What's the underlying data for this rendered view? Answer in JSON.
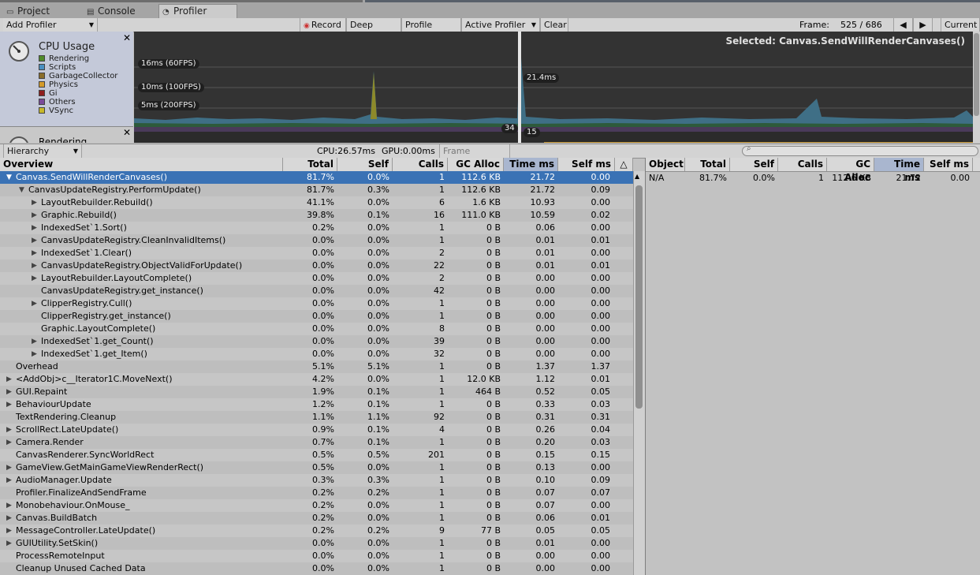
{
  "tabs": [
    {
      "label": "Project",
      "icon": "folder-icon"
    },
    {
      "label": "Console",
      "icon": "console-icon"
    },
    {
      "label": "Profiler",
      "icon": "profiler-icon"
    }
  ],
  "toolbar": {
    "add_profiler": "Add Profiler",
    "record": "Record",
    "deep_profile": "Deep Profile",
    "profile_editor": "Profile Editor",
    "active_profiler": "Active Profiler",
    "clear": "Clear",
    "frame_label": "Frame:",
    "frame_value": "525 / 686",
    "current": "Current"
  },
  "cpu_panel": {
    "title": "CPU Usage",
    "legend": [
      {
        "label": "Rendering",
        "color": "#4f8a2a"
      },
      {
        "label": "Scripts",
        "color": "#4a8fc1"
      },
      {
        "label": "GarbageCollector",
        "color": "#8a6d2a"
      },
      {
        "label": "Physics",
        "color": "#d49a2a"
      },
      {
        "label": "Gi",
        "color": "#8e1e1e"
      },
      {
        "label": "Others",
        "color": "#7a4a9a"
      },
      {
        "label": "VSync",
        "color": "#c7b82a"
      }
    ],
    "selected_text": "Selected: Canvas.SendWillRenderCanvases()",
    "lines": [
      {
        "label": "16ms (60FPS)"
      },
      {
        "label": "10ms (100FPS)"
      },
      {
        "label": "5ms (200FPS)"
      }
    ],
    "peak_label": "21.4ms",
    "marker_left": "34",
    "marker_right": "15"
  },
  "render_panel": {
    "title": "Rendering"
  },
  "stats_bar": {
    "view": "Hierarchy",
    "cpu": "CPU:26.57ms",
    "gpu": "GPU:0.00ms",
    "frame_debugger": "Frame Debugger"
  },
  "table": {
    "headers": [
      "Overview",
      "Total",
      "Self",
      "Calls",
      "GC Alloc",
      "Time ms",
      "Self ms"
    ],
    "rows": [
      {
        "indent": 0,
        "arrow": "▼",
        "name": "Canvas.SendWillRenderCanvases()",
        "total": "81.7%",
        "self": "0.0%",
        "calls": "1",
        "gc": "112.6 KB",
        "time": "21.72",
        "selfms": "0.00",
        "selected": true
      },
      {
        "indent": 1,
        "arrow": "▼",
        "name": "CanvasUpdateRegistry.PerformUpdate()",
        "total": "81.7%",
        "self": "0.3%",
        "calls": "1",
        "gc": "112.6 KB",
        "time": "21.72",
        "selfms": "0.09"
      },
      {
        "indent": 2,
        "arrow": "▶",
        "name": "LayoutRebuilder.Rebuild()",
        "total": "41.1%",
        "self": "0.0%",
        "calls": "6",
        "gc": "1.6 KB",
        "time": "10.93",
        "selfms": "0.00"
      },
      {
        "indent": 2,
        "arrow": "▶",
        "name": "Graphic.Rebuild()",
        "total": "39.8%",
        "self": "0.1%",
        "calls": "16",
        "gc": "111.0 KB",
        "time": "10.59",
        "selfms": "0.02"
      },
      {
        "indent": 2,
        "arrow": "▶",
        "name": "IndexedSet`1.Sort()",
        "total": "0.2%",
        "self": "0.0%",
        "calls": "1",
        "gc": "0 B",
        "time": "0.06",
        "selfms": "0.00"
      },
      {
        "indent": 2,
        "arrow": "▶",
        "name": "CanvasUpdateRegistry.CleanInvalidItems()",
        "total": "0.0%",
        "self": "0.0%",
        "calls": "1",
        "gc": "0 B",
        "time": "0.01",
        "selfms": "0.01"
      },
      {
        "indent": 2,
        "arrow": "▶",
        "name": "IndexedSet`1.Clear()",
        "total": "0.0%",
        "self": "0.0%",
        "calls": "2",
        "gc": "0 B",
        "time": "0.01",
        "selfms": "0.00"
      },
      {
        "indent": 2,
        "arrow": "▶",
        "name": "CanvasUpdateRegistry.ObjectValidForUpdate()",
        "total": "0.0%",
        "self": "0.0%",
        "calls": "22",
        "gc": "0 B",
        "time": "0.01",
        "selfms": "0.01"
      },
      {
        "indent": 2,
        "arrow": "▶",
        "name": "LayoutRebuilder.LayoutComplete()",
        "total": "0.0%",
        "self": "0.0%",
        "calls": "2",
        "gc": "0 B",
        "time": "0.00",
        "selfms": "0.00"
      },
      {
        "indent": 2,
        "arrow": "",
        "name": "CanvasUpdateRegistry.get_instance()",
        "total": "0.0%",
        "self": "0.0%",
        "calls": "42",
        "gc": "0 B",
        "time": "0.00",
        "selfms": "0.00"
      },
      {
        "indent": 2,
        "arrow": "▶",
        "name": "ClipperRegistry.Cull()",
        "total": "0.0%",
        "self": "0.0%",
        "calls": "1",
        "gc": "0 B",
        "time": "0.00",
        "selfms": "0.00"
      },
      {
        "indent": 2,
        "arrow": "",
        "name": "ClipperRegistry.get_instance()",
        "total": "0.0%",
        "self": "0.0%",
        "calls": "1",
        "gc": "0 B",
        "time": "0.00",
        "selfms": "0.00"
      },
      {
        "indent": 2,
        "arrow": "",
        "name": "Graphic.LayoutComplete()",
        "total": "0.0%",
        "self": "0.0%",
        "calls": "8",
        "gc": "0 B",
        "time": "0.00",
        "selfms": "0.00"
      },
      {
        "indent": 2,
        "arrow": "▶",
        "name": "IndexedSet`1.get_Count()",
        "total": "0.0%",
        "self": "0.0%",
        "calls": "39",
        "gc": "0 B",
        "time": "0.00",
        "selfms": "0.00"
      },
      {
        "indent": 2,
        "arrow": "▶",
        "name": "IndexedSet`1.get_Item()",
        "total": "0.0%",
        "self": "0.0%",
        "calls": "32",
        "gc": "0 B",
        "time": "0.00",
        "selfms": "0.00"
      },
      {
        "indent": 0,
        "arrow": "",
        "name": "Overhead",
        "total": "5.1%",
        "self": "5.1%",
        "calls": "1",
        "gc": "0 B",
        "time": "1.37",
        "selfms": "1.37"
      },
      {
        "indent": 0,
        "arrow": "▶",
        "name": "<AddObj>c__Iterator1C.MoveNext()",
        "total": "4.2%",
        "self": "0.0%",
        "calls": "1",
        "gc": "12.0 KB",
        "time": "1.12",
        "selfms": "0.01"
      },
      {
        "indent": 0,
        "arrow": "▶",
        "name": "GUI.Repaint",
        "total": "1.9%",
        "self": "0.1%",
        "calls": "1",
        "gc": "464 B",
        "time": "0.52",
        "selfms": "0.05"
      },
      {
        "indent": 0,
        "arrow": "▶",
        "name": "BehaviourUpdate",
        "total": "1.2%",
        "self": "0.1%",
        "calls": "1",
        "gc": "0 B",
        "time": "0.33",
        "selfms": "0.03"
      },
      {
        "indent": 0,
        "arrow": "",
        "name": "TextRendering.Cleanup",
        "total": "1.1%",
        "self": "1.1%",
        "calls": "92",
        "gc": "0 B",
        "time": "0.31",
        "selfms": "0.31"
      },
      {
        "indent": 0,
        "arrow": "▶",
        "name": "ScrollRect.LateUpdate()",
        "total": "0.9%",
        "self": "0.1%",
        "calls": "4",
        "gc": "0 B",
        "time": "0.26",
        "selfms": "0.04"
      },
      {
        "indent": 0,
        "arrow": "▶",
        "name": "Camera.Render",
        "total": "0.7%",
        "self": "0.1%",
        "calls": "1",
        "gc": "0 B",
        "time": "0.20",
        "selfms": "0.03"
      },
      {
        "indent": 0,
        "arrow": "",
        "name": "CanvasRenderer.SyncWorldRect",
        "total": "0.5%",
        "self": "0.5%",
        "calls": "201",
        "gc": "0 B",
        "time": "0.15",
        "selfms": "0.15"
      },
      {
        "indent": 0,
        "arrow": "▶",
        "name": "GameView.GetMainGameViewRenderRect()",
        "total": "0.5%",
        "self": "0.0%",
        "calls": "1",
        "gc": "0 B",
        "time": "0.13",
        "selfms": "0.00"
      },
      {
        "indent": 0,
        "arrow": "▶",
        "name": "AudioManager.Update",
        "total": "0.3%",
        "self": "0.3%",
        "calls": "1",
        "gc": "0 B",
        "time": "0.10",
        "selfms": "0.09"
      },
      {
        "indent": 0,
        "arrow": "",
        "name": "Profiler.FinalizeAndSendFrame",
        "total": "0.2%",
        "self": "0.2%",
        "calls": "1",
        "gc": "0 B",
        "time": "0.07",
        "selfms": "0.07"
      },
      {
        "indent": 0,
        "arrow": "▶",
        "name": "Monobehaviour.OnMouse_",
        "total": "0.2%",
        "self": "0.0%",
        "calls": "1",
        "gc": "0 B",
        "time": "0.07",
        "selfms": "0.00"
      },
      {
        "indent": 0,
        "arrow": "▶",
        "name": "Canvas.BuildBatch",
        "total": "0.2%",
        "self": "0.0%",
        "calls": "1",
        "gc": "0 B",
        "time": "0.06",
        "selfms": "0.01"
      },
      {
        "indent": 0,
        "arrow": "▶",
        "name": "MessageController.LateUpdate()",
        "total": "0.2%",
        "self": "0.2%",
        "calls": "9",
        "gc": "77 B",
        "time": "0.05",
        "selfms": "0.05"
      },
      {
        "indent": 0,
        "arrow": "▶",
        "name": "GUIUtility.SetSkin()",
        "total": "0.0%",
        "self": "0.0%",
        "calls": "1",
        "gc": "0 B",
        "time": "0.01",
        "selfms": "0.00"
      },
      {
        "indent": 0,
        "arrow": "",
        "name": "ProcessRemoteInput",
        "total": "0.0%",
        "self": "0.0%",
        "calls": "1",
        "gc": "0 B",
        "time": "0.00",
        "selfms": "0.00"
      },
      {
        "indent": 0,
        "arrow": "",
        "name": "Cleanup Unused Cached Data",
        "total": "0.0%",
        "self": "0.0%",
        "calls": "1",
        "gc": "0 B",
        "time": "0.00",
        "selfms": "0.00"
      }
    ]
  },
  "detail_table": {
    "headers": [
      "Object",
      "Total",
      "Self",
      "Calls",
      "GC Alloc",
      "Time ms",
      "Self ms"
    ],
    "row": {
      "object": "N/A",
      "total": "81.7%",
      "self": "0.0%",
      "calls": "1",
      "gc": "112.6 KB",
      "time": "21.72",
      "selfms": "0.00"
    }
  }
}
